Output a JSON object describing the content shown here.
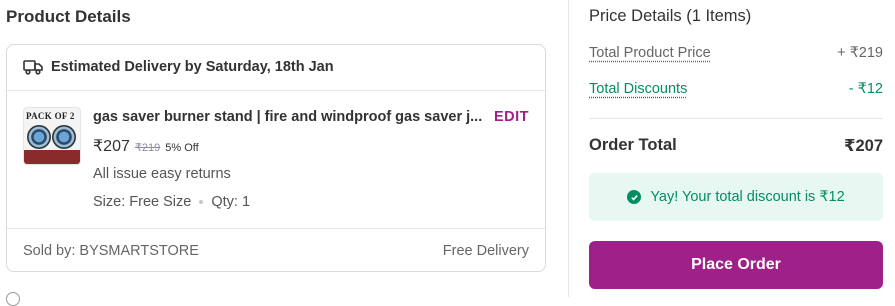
{
  "left": {
    "title": "Product Details",
    "delivery": "Estimated Delivery by Saturday, 18th Jan",
    "product": {
      "thumb_text": "PACK OF 2",
      "name": "gas saver burner stand | fire and windproof gas saver j...",
      "edit_label": "EDIT",
      "price": "₹207",
      "mrp": "₹219",
      "discount": "5% Off",
      "returns": "All issue easy returns",
      "size": "Size: Free Size",
      "qty": "Qty: 1"
    },
    "sold_by": "Sold by: BYSMARTSTORE",
    "delivery_fee": "Free Delivery"
  },
  "right": {
    "title": "Price Details (1 Items)",
    "total_product_price_label": "Total Product Price",
    "total_product_price_value": "+ ₹219",
    "total_discounts_label": "Total Discounts",
    "total_discounts_value": "- ₹12",
    "order_total_label": "Order Total",
    "order_total_value": "₹207",
    "discount_banner": "Yay! Your total discount is ₹12",
    "place_order_label": "Place Order"
  },
  "colors": {
    "brand": "#9f2089",
    "success": "#038d63",
    "success_bg": "#e7f8f2"
  }
}
